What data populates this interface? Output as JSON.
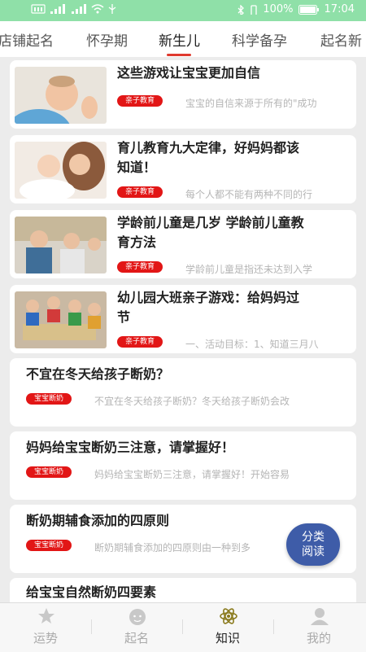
{
  "status_bar": {
    "battery": "100%",
    "time": "17:04"
  },
  "tabs": [
    "店铺起名",
    "怀孕期",
    "新生儿",
    "科学备孕",
    "起名新"
  ],
  "active_tab": "新生儿",
  "articles": [
    {
      "title_lines": [
        "这些游戏让宝宝更加自信"
      ],
      "tag": "亲子教育",
      "summary": "宝宝的自信来源于所有的\"成功",
      "has_image": true
    },
    {
      "title_lines": [
        "育儿教育九大定律，好妈妈都该",
        "知道！"
      ],
      "tag": "亲子教育",
      "summary": "每个人都不能有两种不同的行",
      "has_image": true
    },
    {
      "title_lines": [
        "学龄前儿童是几岁 学龄前儿童教",
        "育方法"
      ],
      "tag": "亲子教育",
      "summary": "学龄前儿童是指还未达到入学",
      "has_image": true
    },
    {
      "title_lines": [
        "幼儿园大班亲子游戏：给妈妈过",
        "节"
      ],
      "tag": "亲子教育",
      "summary": "一、活动目标：1、知道三月八",
      "has_image": true
    },
    {
      "title_lines": [
        "不宜在冬天给孩子断奶？"
      ],
      "tag": "宝宝断奶",
      "summary": "不宜在冬天给孩子断奶？冬天给孩子断奶会改",
      "has_image": false
    },
    {
      "title_lines": [
        "妈妈给宝宝断奶三注意，请掌握好！"
      ],
      "tag": "宝宝断奶",
      "summary": "妈妈给宝宝断奶三注意，请掌握好！开始容易",
      "has_image": false
    },
    {
      "title_lines": [
        "断奶期辅食添加的四原则"
      ],
      "tag": "宝宝断奶",
      "summary": "断奶期辅食添加的四原则由一种到多",
      "has_image": false
    },
    {
      "title_lines": [
        "给宝宝自然断奶四要素"
      ],
      "tag": "",
      "summary": "",
      "has_image": false
    }
  ],
  "fab": {
    "line1": "分类",
    "line2": "阅读"
  },
  "bottom_nav": [
    {
      "label": "运势",
      "icon": "star-hand-icon"
    },
    {
      "label": "起名",
      "icon": "baby-face-icon"
    },
    {
      "label": "知识",
      "icon": "atom-icon"
    },
    {
      "label": "我的",
      "icon": "person-icon"
    }
  ],
  "active_nav": "知识",
  "colors": {
    "accent": "#e03a2f",
    "tag": "#e21616",
    "fab": "#3e5ca8",
    "status_bar": "#8fe0a8"
  }
}
